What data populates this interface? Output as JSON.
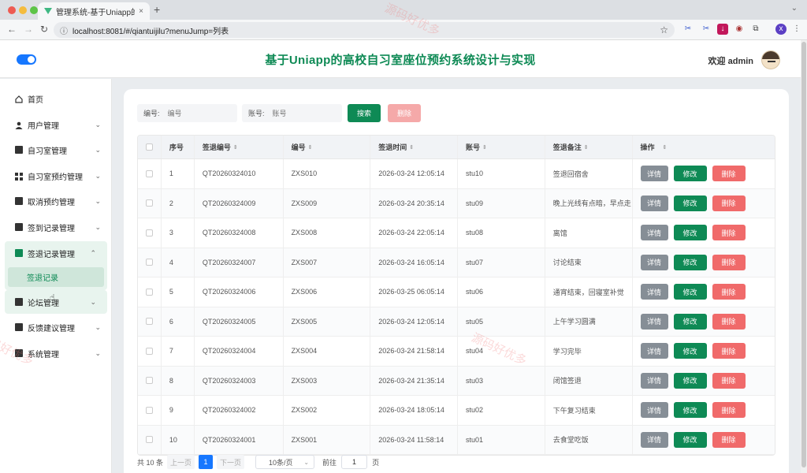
{
  "browser": {
    "tab_title": "管理系统-基于Uniapp的高校自",
    "tab_close": "×",
    "new_tab": "+",
    "url": "localhost:8081/#/qiantuijilu?menuJump=列表",
    "nav_back": "←",
    "nav_forward": "→",
    "nav_reload": "↻",
    "star": "☆",
    "profile_initial": "x"
  },
  "header": {
    "title": "基于Uniapp的高校自习室座位预约系统设计与实现",
    "welcome": "欢迎 admin"
  },
  "sidebar": {
    "items": [
      {
        "label": "首页",
        "icon": "home-icon",
        "chevron": ""
      },
      {
        "label": "用户管理",
        "icon": "user-icon",
        "chevron": "⌄"
      },
      {
        "label": "自习室管理",
        "icon": "room-icon",
        "chevron": "⌄"
      },
      {
        "label": "自习室预约管理",
        "icon": "grid-icon",
        "chevron": "⌄"
      },
      {
        "label": "取消预约管理",
        "icon": "card-icon",
        "chevron": "⌄"
      },
      {
        "label": "签到记录管理",
        "icon": "checkin-icon",
        "chevron": "⌄"
      },
      {
        "label": "签退记录管理",
        "icon": "checkout-icon",
        "chevron": "⌃"
      },
      {
        "label": "论坛管理",
        "icon": "forum-icon",
        "chevron": "⌄"
      },
      {
        "label": "反馈建议管理",
        "icon": "feedback-icon",
        "chevron": "⌄"
      },
      {
        "label": "系统管理",
        "icon": "settings-icon",
        "chevron": "⌄"
      }
    ],
    "sub_item": "签退记录"
  },
  "filters": {
    "code_label": "编号:",
    "code_placeholder": "编号",
    "account_label": "账号:",
    "account_placeholder": "账号",
    "search_label": "搜索",
    "delete_label": "删除"
  },
  "table": {
    "sort_glyph": "⇕",
    "headers": [
      "序号",
      "签退编号",
      "编号",
      "签退时间",
      "账号",
      "签退备注",
      "操作"
    ],
    "actions": {
      "detail": "详情",
      "edit": "修改",
      "delete": "删除"
    },
    "rows": [
      {
        "no": "1",
        "checkout_code": "QT20260324010",
        "code": "ZXS010",
        "time": "2026-03-24 12:05:14",
        "account": "stu10",
        "remark": "签退回宿舍"
      },
      {
        "no": "2",
        "checkout_code": "QT20260324009",
        "code": "ZXS009",
        "time": "2026-03-24 20:35:14",
        "account": "stu09",
        "remark": "晚上光线有点暗，早点走"
      },
      {
        "no": "3",
        "checkout_code": "QT20260324008",
        "code": "ZXS008",
        "time": "2026-03-24 22:05:14",
        "account": "stu08",
        "remark": "离馆"
      },
      {
        "no": "4",
        "checkout_code": "QT20260324007",
        "code": "ZXS007",
        "time": "2026-03-24 16:05:14",
        "account": "stu07",
        "remark": "讨论结束"
      },
      {
        "no": "5",
        "checkout_code": "QT20260324006",
        "code": "ZXS006",
        "time": "2026-03-25 06:05:14",
        "account": "stu06",
        "remark": "通宵结束，回寝室补觉"
      },
      {
        "no": "6",
        "checkout_code": "QT20260324005",
        "code": "ZXS005",
        "time": "2026-03-24 12:05:14",
        "account": "stu05",
        "remark": "上午学习圆满"
      },
      {
        "no": "7",
        "checkout_code": "QT20260324004",
        "code": "ZXS004",
        "time": "2026-03-24 21:58:14",
        "account": "stu04",
        "remark": "学习完毕"
      },
      {
        "no": "8",
        "checkout_code": "QT20260324003",
        "code": "ZXS003",
        "time": "2026-03-24 21:35:14",
        "account": "stu03",
        "remark": "闭馆签退"
      },
      {
        "no": "9",
        "checkout_code": "QT20260324002",
        "code": "ZXS002",
        "time": "2026-03-24 18:05:14",
        "account": "stu02",
        "remark": "下午复习结束"
      },
      {
        "no": "10",
        "checkout_code": "QT20260324001",
        "code": "ZXS001",
        "time": "2026-03-24 11:58:14",
        "account": "stu01",
        "remark": "去食堂吃饭"
      }
    ]
  },
  "pagination": {
    "total": "共 10 条",
    "prev": "上一页",
    "current_page": "1",
    "next": "下一页",
    "page_size": "10条/页",
    "goto_label": "前往",
    "goto_value": "1",
    "page_unit": "页"
  },
  "watermark": "源码好优多",
  "colors": {
    "brand_green": "#0e8a55",
    "delete_red": "#f06a6a",
    "accent_blue": "#1677ff"
  }
}
